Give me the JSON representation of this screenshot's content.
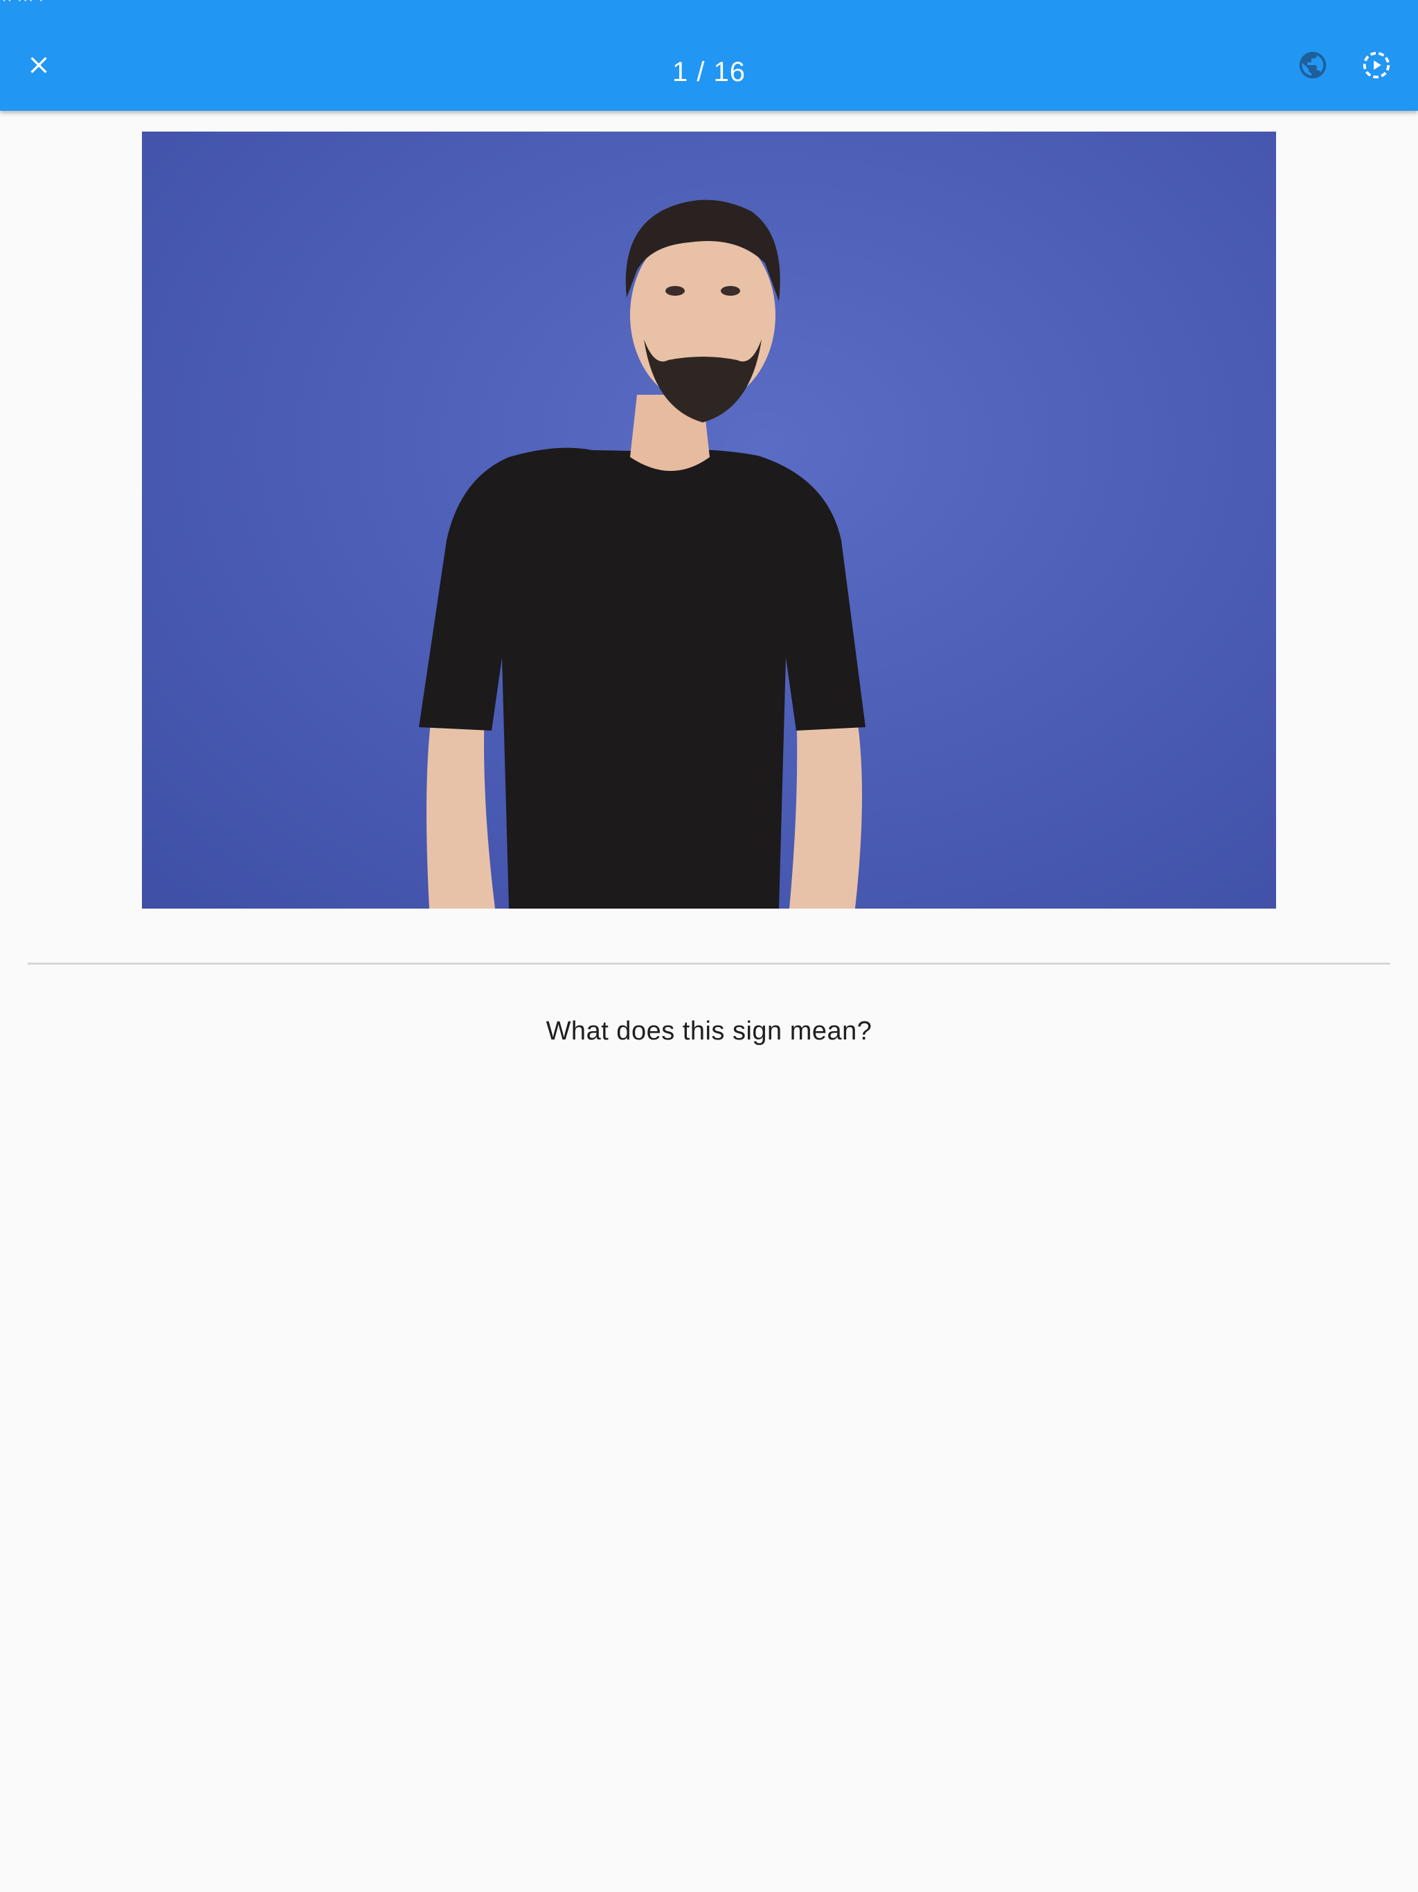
{
  "status_bar": {
    "text": "·· ··· ·"
  },
  "app_bar": {
    "title": "1 / 16",
    "color": "#2196f3",
    "icons": {
      "close": "close-icon",
      "language": "globe-icon",
      "autoplay": "play-circle-icon"
    }
  },
  "media": {
    "description_kind": "sign-language-video",
    "background_color": "#4e5fb8"
  },
  "question": {
    "text": "What does this sign mean?"
  }
}
